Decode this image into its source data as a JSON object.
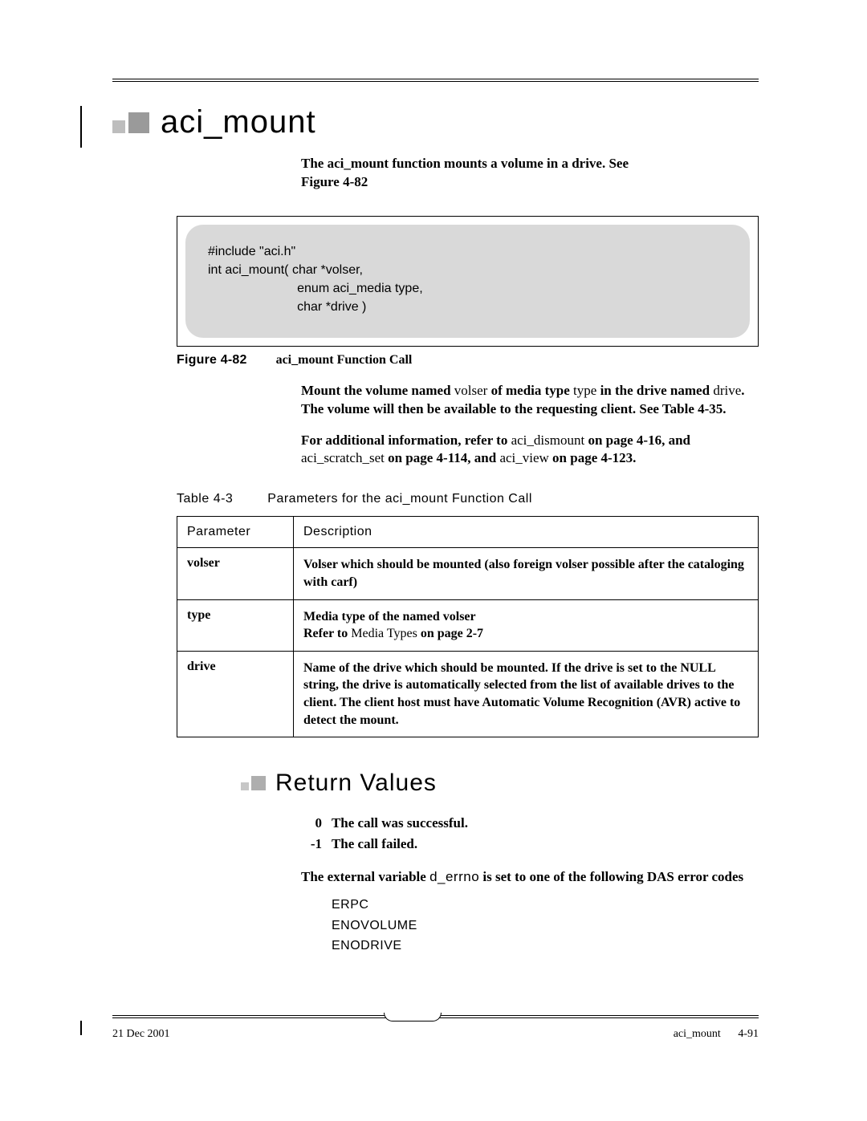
{
  "heading": "aci_mount",
  "intro": {
    "line1": "The aci_mount function mounts a volume in a drive. See",
    "line2": "Figure 4-82"
  },
  "code": {
    "l1": "#include \"aci.h\"",
    "l2": "int aci_mount( char *volser,",
    "l3": "                         enum aci_media type,",
    "l4": "                         char *drive )"
  },
  "figure": {
    "label": "Figure 4-82",
    "title": "aci_mount Function Call"
  },
  "para1": {
    "a": "Mount the volume named ",
    "volser": "volser",
    "b": " of media type ",
    "type": "type",
    "c": " in the drive named ",
    "drive": "drive",
    "d": ". The volume will then be available to the requesting client. See Table 4-35."
  },
  "para2": {
    "a": "For additional information, refer to ",
    "r1": "aci_dismount",
    "b": "  on page 4-16, and ",
    "r2": "aci_scratch_set",
    "c": "  on page 4-114, and ",
    "r3": "aci_view",
    "d": "  on page 4-123."
  },
  "table": {
    "label": "Table 4-3",
    "title": "Parameters for the aci_mount Function Call",
    "headers": {
      "param": "Parameter",
      "desc": "Description"
    },
    "rows": [
      {
        "param": "volser",
        "desc": "Volser which should be mounted (also foreign volser possible after the cataloging with carf)"
      },
      {
        "param": "type",
        "desc_line1": "Media type of the named volser",
        "desc_line2a": "Refer to ",
        "desc_line2_link": "Media Types",
        "desc_line2b": "  on page 2-7"
      },
      {
        "param": "drive",
        "desc": "Name of the drive which should be mounted. If the drive is set to the NULL string, the drive is automatically selected from the list of available drives to the client. The client host must have Automatic Volume Recognition (AVR) active to detect the mount."
      }
    ]
  },
  "return_heading": "Return Values",
  "return_values": {
    "r0_code": "0",
    "r0_text": "The call was successful.",
    "r1_code": "-1",
    "r1_text": "The call failed."
  },
  "errno_intro": {
    "a": "The external variable ",
    "var": "d_errno",
    "b": "    is set to one of the following DAS error codes"
  },
  "errno_codes": [
    "ERPC",
    "ENOVOLUME",
    "ENODRIVE"
  ],
  "footer": {
    "date": "21 Dec 2001",
    "running": "aci_mount",
    "page": "4-91"
  }
}
